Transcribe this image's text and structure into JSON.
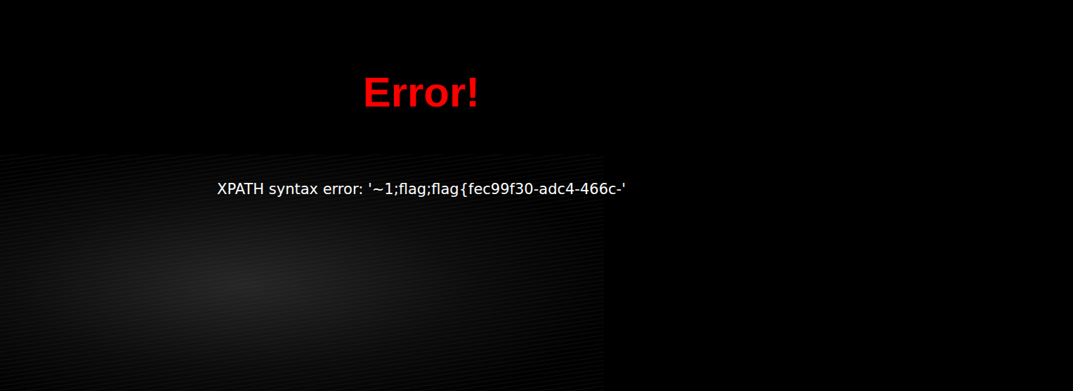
{
  "page": {
    "title": "Error!",
    "message": "XPATH syntax error: '~1;flag;flag{fec99f30-adc4-466c-'"
  }
}
